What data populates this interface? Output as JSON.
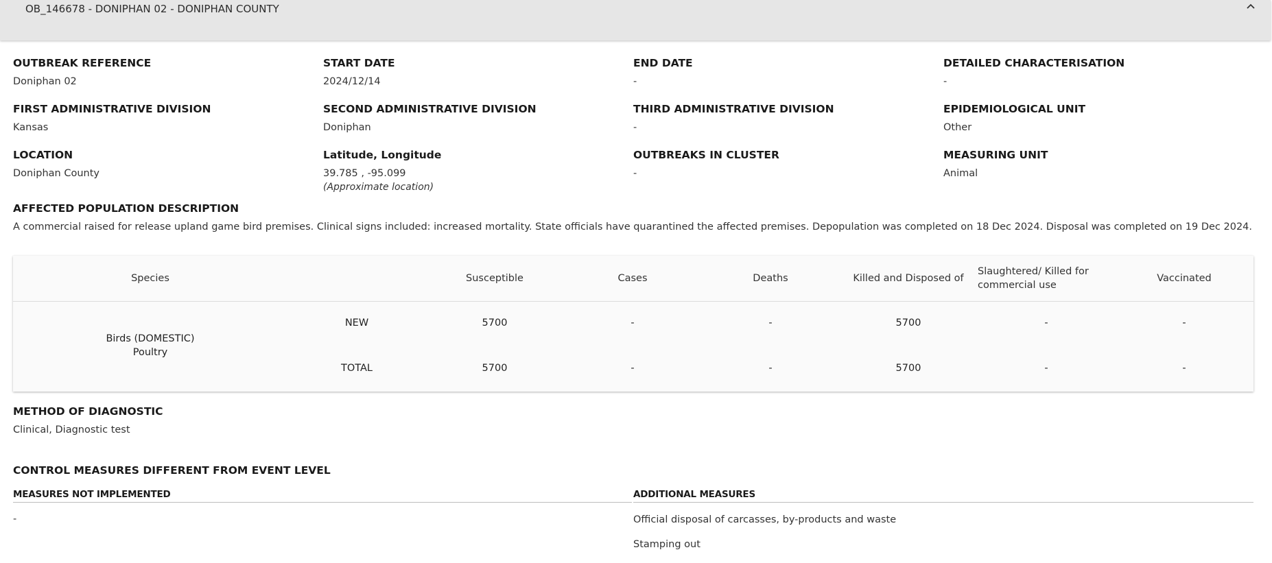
{
  "panel": {
    "title": "OB_146678 - DONIPHAN 02 - DONIPHAN COUNTY",
    "collapse_icon": "chevron-up-icon"
  },
  "fields": {
    "outbreak_reference": {
      "label": "OUTBREAK REFERENCE",
      "value": "Doniphan 02"
    },
    "start_date": {
      "label": "START DATE",
      "value": "2024/12/14"
    },
    "end_date": {
      "label": "END DATE",
      "value": "-"
    },
    "detailed_characterisation": {
      "label": "DETAILED CHARACTERISATION",
      "value": "-"
    },
    "first_admin_division": {
      "label": "FIRST ADMINISTRATIVE DIVISION",
      "value": "Kansas"
    },
    "second_admin_division": {
      "label": "SECOND ADMINISTRATIVE DIVISION",
      "value": "Doniphan"
    },
    "third_admin_division": {
      "label": "THIRD ADMINISTRATIVE DIVISION",
      "value": "-"
    },
    "epidemiological_unit": {
      "label": "EPIDEMIOLOGICAL UNIT",
      "value": "Other"
    },
    "location": {
      "label": "LOCATION",
      "value": "Doniphan County"
    },
    "lat_long": {
      "label": "Latitude, Longitude",
      "value": "39.785 , -95.099",
      "note": "(Approximate location)"
    },
    "outbreaks_in_cluster": {
      "label": "OUTBREAKS IN CLUSTER",
      "value": "-"
    },
    "measuring_unit": {
      "label": "MEASURING UNIT",
      "value": "Animal"
    }
  },
  "affected_population": {
    "label": "AFFECTED POPULATION DESCRIPTION",
    "text": "A commercial raised for release upland game bird premises. Clinical signs included: increased mortality. State officials have quarantined the affected premises. Depopulation was completed on 18 Dec 2024. Disposal was completed on 19 Dec 2024."
  },
  "species_table": {
    "headers": {
      "species": "Species",
      "susceptible": "Susceptible",
      "cases": "Cases",
      "deaths": "Deaths",
      "killed_disposed": "Killed and Disposed of",
      "slaughtered": "Slaughtered/ Killed for commercial use",
      "vaccinated": "Vaccinated"
    },
    "species_name": "Birds (DOMESTIC)",
    "species_sub": "Poultry",
    "rows": [
      {
        "type": "NEW",
        "susceptible": "5700",
        "cases": "-",
        "deaths": "-",
        "killed_disposed": "5700",
        "slaughtered": "-",
        "vaccinated": "-"
      },
      {
        "type": "TOTAL",
        "susceptible": "5700",
        "cases": "-",
        "deaths": "-",
        "killed_disposed": "5700",
        "slaughtered": "-",
        "vaccinated": "-"
      }
    ]
  },
  "method_of_diagnostic": {
    "label": "METHOD OF DIAGNOSTIC",
    "value": "Clinical, Diagnostic test"
  },
  "control_measures": {
    "label": "CONTROL MEASURES DIFFERENT FROM EVENT LEVEL",
    "not_implemented_label": "MEASURES NOT IMPLEMENTED",
    "not_implemented": [
      "-"
    ],
    "additional_label": "ADDITIONAL MEASURES",
    "additional": [
      "Official disposal of carcasses, by-products and waste",
      "Stamping out"
    ]
  }
}
